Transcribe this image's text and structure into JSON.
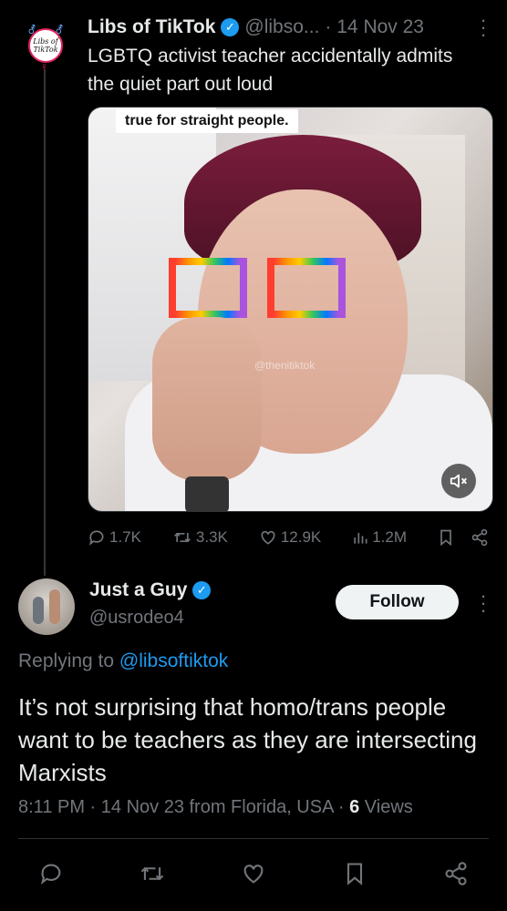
{
  "original_tweet": {
    "author_name": "Libs of TikTok",
    "handle": "@libso...",
    "date": "· 14 Nov 23",
    "text": "LGBTQ activist teacher accidentally admits the quiet part out loud",
    "avatar_text": "Libs of TikTok",
    "media": {
      "caption": "true for straight people.",
      "watermark": "@thenitiktok"
    },
    "actions": {
      "replies": "1.7K",
      "retweets": "3.3K",
      "likes": "12.9K",
      "views": "1.2M"
    }
  },
  "reply_tweet": {
    "author_name": "Just a Guy",
    "handle": "@usrodeo4",
    "follow_label": "Follow",
    "replying_prefix": "Replying to",
    "replying_to": "@libsoftiktok",
    "text": "It’s not surprising that homo/trans people want to be teachers as they are intersecting Marxists",
    "timestamp": "8:11 PM · 14 Nov 23 from Florida, USA ·",
    "views_count": "6",
    "views_label": "Views"
  },
  "colors": {
    "background": "#000000",
    "text_primary": "#e7e9ea",
    "text_secondary": "#71767b",
    "accent": "#1d9bf0",
    "divider": "#2f3336"
  },
  "icons": [
    "reply-icon",
    "retweet-icon",
    "like-icon",
    "views-icon",
    "bookmark-icon",
    "share-icon",
    "verified-icon",
    "more-icon",
    "mute-icon"
  ]
}
